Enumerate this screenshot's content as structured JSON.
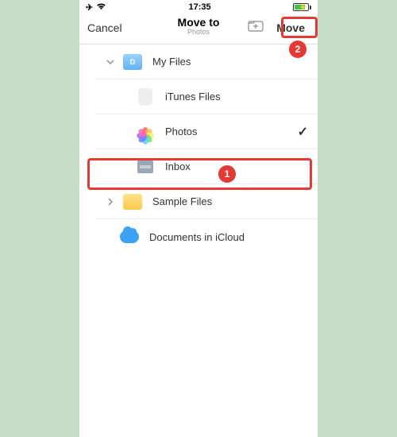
{
  "status": {
    "time": "17:35"
  },
  "header": {
    "cancel": "Cancel",
    "title": "Move to",
    "subtitle": "Photos",
    "move": "Move"
  },
  "rows": {
    "myfiles": "My Files",
    "itunes": "iTunes Files",
    "photos": "Photos",
    "inbox": "Inbox",
    "sample": "Sample Files",
    "icloud": "Documents in iCloud"
  },
  "callouts": {
    "one": "1",
    "two": "2"
  }
}
